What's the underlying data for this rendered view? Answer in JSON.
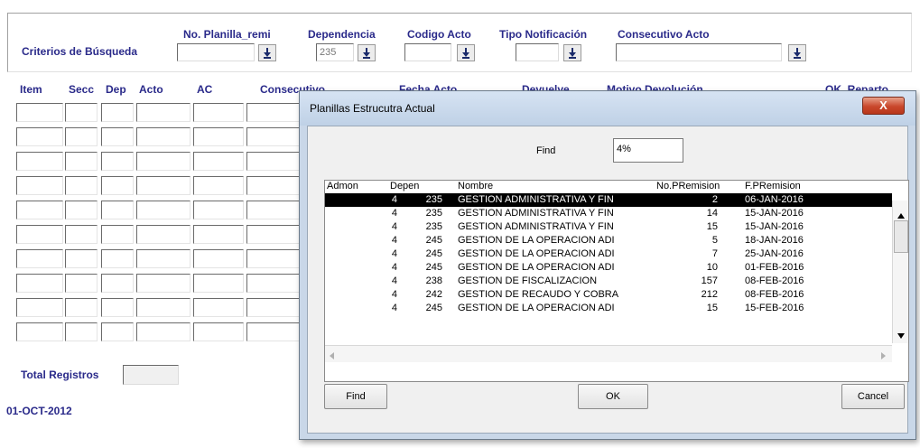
{
  "criteria": {
    "title": "Criterios de Búsqueda",
    "no_planilla_label": "No. Planilla_remi",
    "dependencia_label": "Dependencia",
    "dependencia_value": "235",
    "codigo_acto_label": "Codigo Acto",
    "tipo_notificacion_label": "Tipo Notificación",
    "consecutivo_acto_label": "Consecutivo Acto"
  },
  "grid": {
    "columns": [
      "Item",
      "Secc",
      "Dep",
      "Acto",
      "AC",
      "Consecutivo",
      "Fecha Acto",
      "Devuelve",
      "Motivo Devolución",
      "OK_Reparto"
    ],
    "row_count": 10
  },
  "footer": {
    "total_label": "Total Registros",
    "total_value": "",
    "date": "01-OCT-2012"
  },
  "dialog": {
    "title": "Planillas Estrucutra Actual",
    "close_label": "X",
    "find_label": "Find",
    "find_value": "4%",
    "headers": [
      "Admon",
      "Depen",
      "Nombre",
      "No.PRemision",
      "F.PRemision"
    ],
    "rows": [
      {
        "admon": "4",
        "depen": "235",
        "nombre": "GESTION ADMINISTRATIVA Y FIN",
        "no": "2",
        "fecha": "06-JAN-2016",
        "selected": true
      },
      {
        "admon": "4",
        "depen": "235",
        "nombre": "GESTION ADMINISTRATIVA Y FIN",
        "no": "14",
        "fecha": "15-JAN-2016"
      },
      {
        "admon": "4",
        "depen": "235",
        "nombre": "GESTION ADMINISTRATIVA Y FIN",
        "no": "15",
        "fecha": "15-JAN-2016"
      },
      {
        "admon": "4",
        "depen": "245",
        "nombre": "GESTION DE LA OPERACION ADI",
        "no": "5",
        "fecha": "18-JAN-2016"
      },
      {
        "admon": "4",
        "depen": "245",
        "nombre": "GESTION DE LA OPERACION ADI",
        "no": "7",
        "fecha": "25-JAN-2016"
      },
      {
        "admon": "4",
        "depen": "245",
        "nombre": "GESTION DE LA OPERACION ADI",
        "no": "10",
        "fecha": "01-FEB-2016"
      },
      {
        "admon": "4",
        "depen": "238",
        "nombre": "GESTION DE FISCALIZACION",
        "no": "157",
        "fecha": "08-FEB-2016"
      },
      {
        "admon": "4",
        "depen": "242",
        "nombre": "GESTION DE RECAUDO Y COBRA",
        "no": "212",
        "fecha": "08-FEB-2016"
      },
      {
        "admon": "4",
        "depen": "245",
        "nombre": "GESTION DE LA OPERACION ADI",
        "no": "15",
        "fecha": "15-FEB-2016"
      }
    ],
    "find_button": "Find",
    "ok_button": "OK",
    "cancel_button": "Cancel"
  },
  "colors": {
    "label_navy": "#2a2a8a",
    "selection": "#000000",
    "close_red": "#c9482c"
  }
}
